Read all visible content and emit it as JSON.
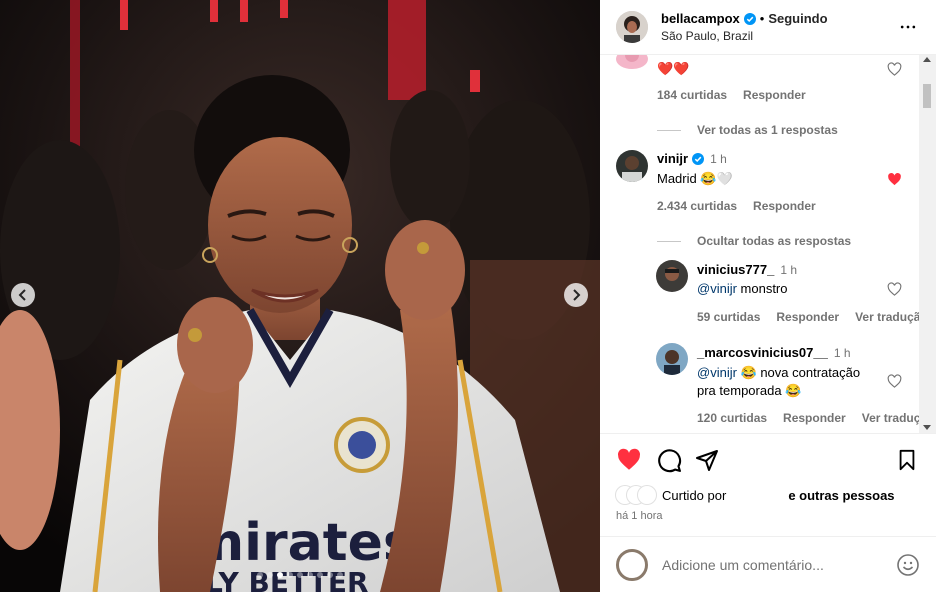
{
  "post": {
    "username": "bellacampox",
    "separator": "•",
    "follow_status": "Seguindo",
    "location": "São Paulo, Brazil"
  },
  "photo": {
    "jersey_text_line1": "mirates",
    "jersey_text_line2": "LY BETTER",
    "carousel_dot_count": 9,
    "carousel_active_index": 2
  },
  "comments": {
    "partial": {
      "text": "❤️❤️",
      "likes": "184 curtidas",
      "reply": "Responder"
    },
    "view_replies": "Ver todas as 1 respostas",
    "vinijr": {
      "username": "vinijr",
      "time": "1 h",
      "text": "Madrid 😂🤍",
      "likes": "2.434 curtidas",
      "reply": "Responder",
      "liked": true
    },
    "hide_replies": "Ocultar todas as respostas",
    "replies": [
      {
        "username": "vinicius777_",
        "time": "1 h",
        "mention": "@vinijr",
        "text": " monstro",
        "likes": "59 curtidas",
        "reply": "Responder",
        "translate": "Ver tradução"
      },
      {
        "username": "_marcosvinicius07__",
        "time": "1 h",
        "mention": "@vinijr",
        "text_line1": " 😂 nova contratação",
        "text_line2": "pra temporada 😂",
        "likes": "120 curtidas",
        "reply": "Responder",
        "translate": "Ver tradução"
      }
    ]
  },
  "likes_row": {
    "prefix": "Curtido por",
    "suffix": "e outras pessoas"
  },
  "timestamp": "há 1 hora",
  "add_comment": {
    "placeholder": "Adicione um comentário..."
  },
  "colors": {
    "like_red": "#ff3040",
    "verified_blue": "#0095f6",
    "mention_blue": "#00376b",
    "secondary_text": "#737373"
  }
}
